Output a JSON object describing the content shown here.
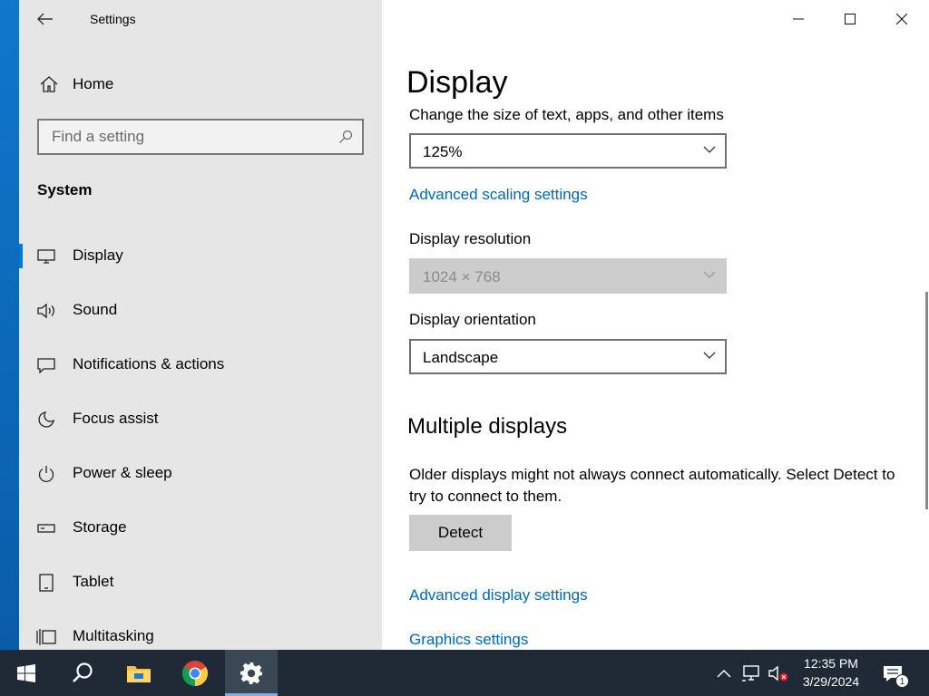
{
  "window": {
    "title": "Settings"
  },
  "sidebar": {
    "home_label": "Home",
    "search_placeholder": "Find a setting",
    "section_title": "System",
    "items": [
      {
        "label": "Display",
        "icon": "monitor-icon",
        "active": true
      },
      {
        "label": "Sound",
        "icon": "speaker-icon"
      },
      {
        "label": "Notifications & actions",
        "icon": "message-icon"
      },
      {
        "label": "Focus assist",
        "icon": "moon-icon"
      },
      {
        "label": "Power & sleep",
        "icon": "power-icon"
      },
      {
        "label": "Storage",
        "icon": "storage-icon"
      },
      {
        "label": "Tablet",
        "icon": "tablet-icon"
      },
      {
        "label": "Multitasking",
        "icon": "multitasking-icon"
      }
    ]
  },
  "main": {
    "title": "Display",
    "scale_label": "Change the size of text, apps, and other items",
    "scale_value": "125%",
    "advanced_scaling_link": "Advanced scaling settings",
    "resolution_label": "Display resolution",
    "resolution_value": "1024 × 768",
    "orientation_label": "Display orientation",
    "orientation_value": "Landscape",
    "multiple_title": "Multiple displays",
    "multiple_desc": "Older displays might not always connect automatically. Select Detect to try to connect to them.",
    "detect_button": "Detect",
    "advanced_display_link": "Advanced display settings",
    "graphics_link": "Graphics settings"
  },
  "taskbar": {
    "apps": [
      "start",
      "search",
      "file-explorer",
      "chrome",
      "settings"
    ],
    "time": "12:35 PM",
    "date": "3/29/2024",
    "notification_count": "1"
  },
  "colors": {
    "accent": "#0078d7",
    "link": "#0067b8",
    "taskbar": "#1f2a36",
    "sidebar": "#e6e6e6"
  }
}
